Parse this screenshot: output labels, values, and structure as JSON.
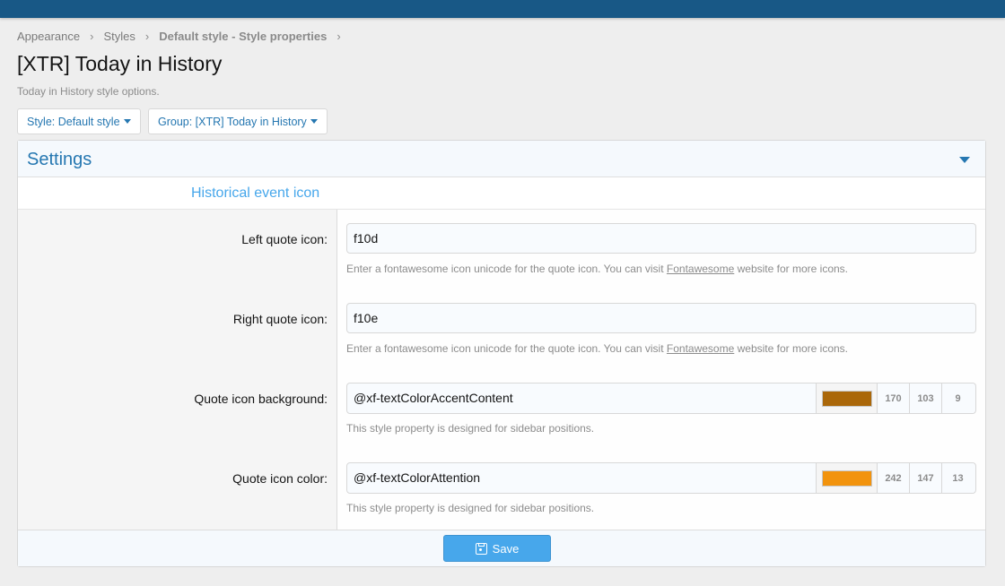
{
  "breadcrumb": {
    "items": [
      "Appearance",
      "Styles",
      "Default style - Style properties"
    ],
    "separator": "›"
  },
  "page": {
    "title": "[XTR] Today in History",
    "description": "Today in History style options."
  },
  "filters": {
    "style_label": "Style: Default style",
    "group_label": "Group: [XTR] Today in History"
  },
  "settings": {
    "title": "Settings",
    "section_title": "Historical event icon"
  },
  "fields": {
    "left_quote": {
      "label": "Left quote icon:",
      "value": "f10d",
      "explain_prefix": "Enter a fontawesome icon unicode for the quote icon. You can visit ",
      "explain_link": "Fontawesome",
      "explain_suffix": " website for more icons."
    },
    "right_quote": {
      "label": "Right quote icon:",
      "value": "f10e",
      "explain_prefix": "Enter a fontawesome icon unicode for the quote icon. You can visit ",
      "explain_link": "Fontawesome",
      "explain_suffix": " website for more icons."
    },
    "quote_bg": {
      "label": "Quote icon background:",
      "value": "@xf-textColorAccentContent",
      "swatch_color": "#aa6709",
      "r": "170",
      "g": "103",
      "b": "9",
      "explain": "This style property is designed for sidebar positions."
    },
    "quote_color": {
      "label": "Quote icon color:",
      "value": "@xf-textColorAttention",
      "swatch_color": "#f2930d",
      "r": "242",
      "g": "147",
      "b": "13",
      "explain": "This style property is designed for sidebar positions."
    }
  },
  "footer": {
    "save_label": "Save"
  },
  "colors": {
    "topbar": "#185886",
    "accent": "#2577b1",
    "button": "#47a7eb"
  }
}
